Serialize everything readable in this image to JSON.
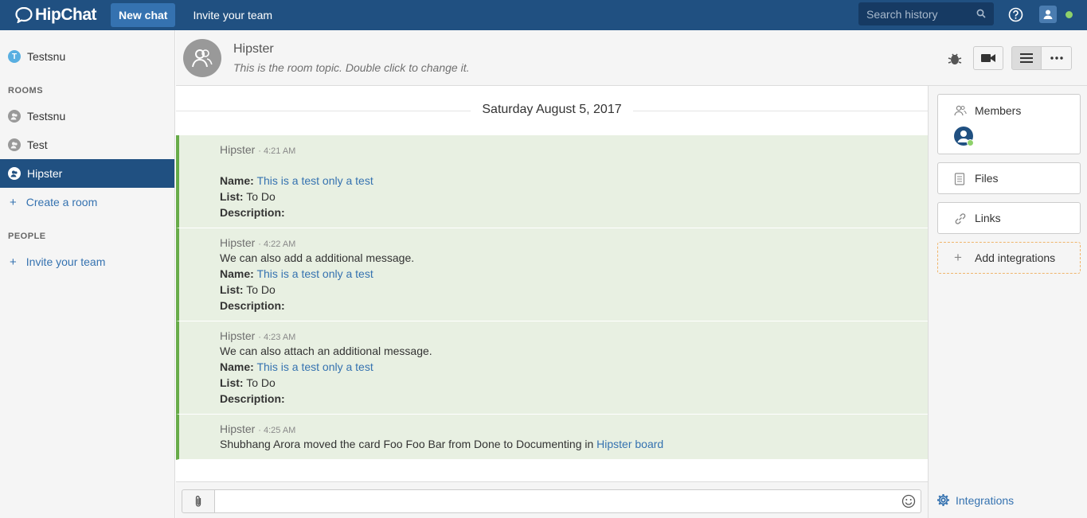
{
  "topbar": {
    "logo_text": "HipChat",
    "new_chat_label": "New chat",
    "invite_label": "Invite your team",
    "search_placeholder": "Search history"
  },
  "sidebar": {
    "user_item": {
      "initial": "T",
      "label": "Testsnu"
    },
    "rooms_header": "ROOMS",
    "rooms": [
      {
        "label": "Testsnu"
      },
      {
        "label": "Test"
      },
      {
        "label": "Hipster",
        "active": true
      }
    ],
    "create_room_label": "Create a room",
    "people_header": "PEOPLE",
    "invite_team_label": "Invite your team"
  },
  "room": {
    "name": "Hipster",
    "topic": "This is the room topic. Double click to change it."
  },
  "chat": {
    "date": "Saturday August 5, 2017",
    "messages": [
      {
        "sender": "Hipster",
        "time": "4:21 AM",
        "text": "",
        "name_label": "Name:",
        "name_value": "This is a test only a test",
        "list_label": "List:",
        "list_value": "To Do",
        "desc_label": "Description:"
      },
      {
        "sender": "Hipster",
        "time": "4:22 AM",
        "text": "We can also add a additional message.",
        "name_label": "Name:",
        "name_value": "This is a test only a test",
        "list_label": "List:",
        "list_value": "To Do",
        "desc_label": "Description:"
      },
      {
        "sender": "Hipster",
        "time": "4:23 AM",
        "text": "We can also attach an additional message.",
        "name_label": "Name:",
        "name_value": "This is a test only a test",
        "list_label": "List:",
        "list_value": "To Do",
        "desc_label": "Description:"
      },
      {
        "sender": "Hipster",
        "time": "4:25 AM",
        "text": "Shubhang Arora moved the card Foo Foo Bar from Done to Documenting in ",
        "link": "Hipster board"
      }
    ],
    "input_placeholder": ""
  },
  "right_panel": {
    "members_label": "Members",
    "files_label": "Files",
    "links_label": "Links",
    "add_integrations_label": "Add integrations",
    "integrations_link": "Integrations"
  },
  "colors": {
    "topbar": "#205081",
    "accent": "#3572b0",
    "message_bg": "#e8f0e2",
    "message_border": "#67ab49",
    "online": "#8ed16a"
  }
}
